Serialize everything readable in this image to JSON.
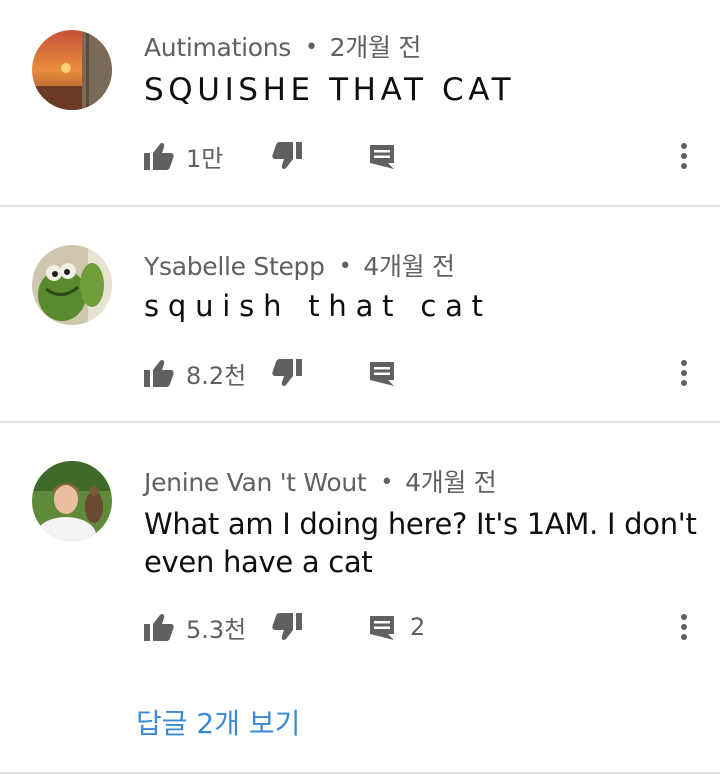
{
  "comments": [
    {
      "author": "Autimations",
      "time": "2개월 전",
      "text": "SQUISHE THAT CAT",
      "likes": "1만",
      "replies": "",
      "avatar_icon": "sunset-avatar"
    },
    {
      "author": "Ysabelle Stepp",
      "time": "4개월 전",
      "text": "squish that cat",
      "likes": "8.2천",
      "replies": "",
      "avatar_icon": "kermit-avatar"
    },
    {
      "author": "Jenine Van 't Wout",
      "time": "4개월 전",
      "text": "What am I doing here?  It's 1AM. I don't even have a cat",
      "likes": "5.3천",
      "replies": "2",
      "avatar_icon": "woman-with-bird-avatar"
    }
  ],
  "view_replies": "답글 2개 보기",
  "colors": {
    "meta": "#606060",
    "icon": "#606060",
    "link": "#3a8ad8",
    "divider": "#e3e3e3"
  },
  "icons": [
    "thumbs-up-icon",
    "thumbs-down-icon",
    "reply-icon",
    "more-vert-icon"
  ]
}
